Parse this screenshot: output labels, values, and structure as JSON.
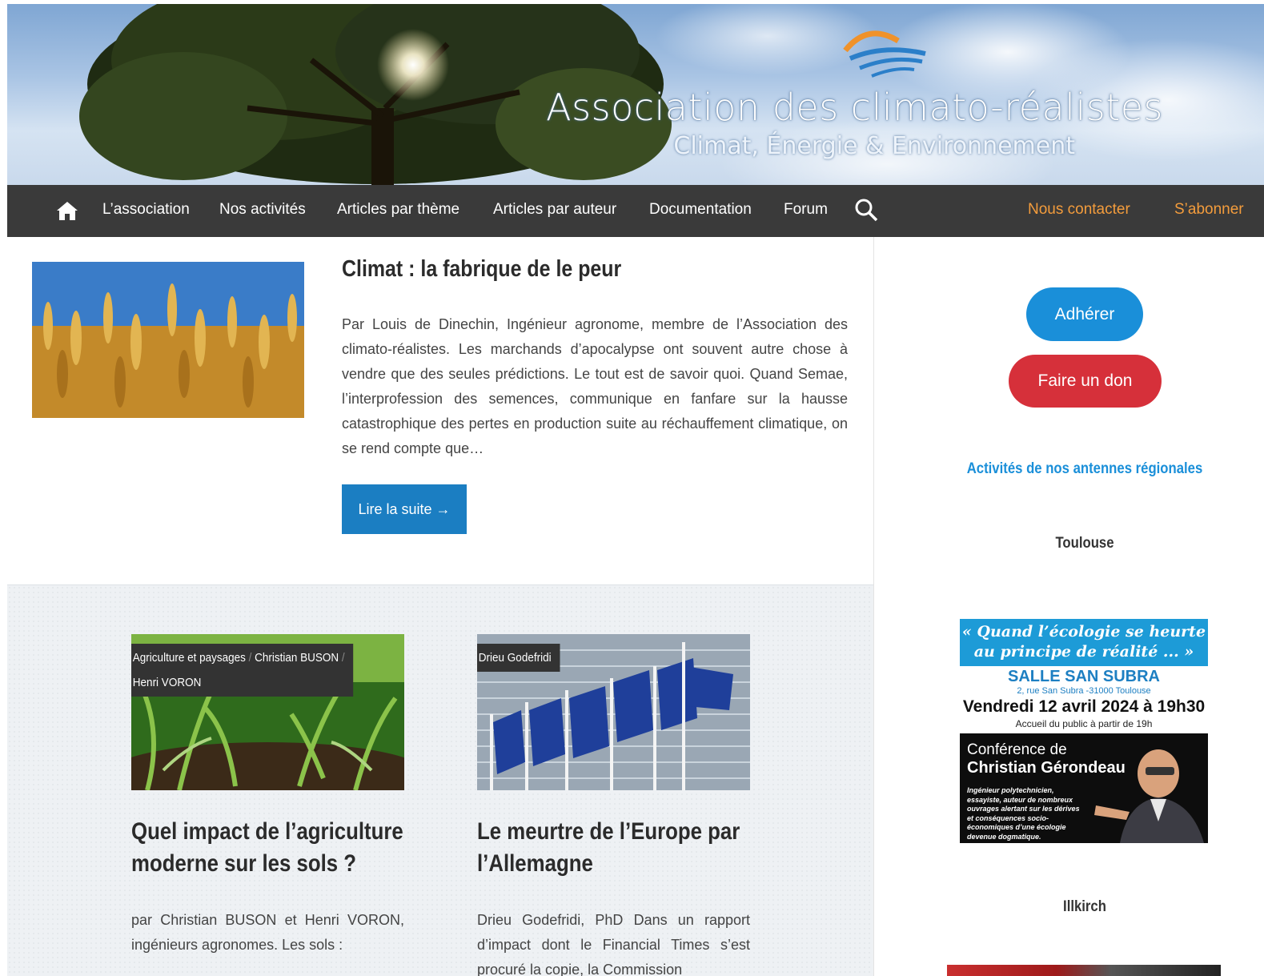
{
  "header": {
    "site_title": "Association des climato-réalistes",
    "tagline": "Climat, Énergie & Environnement"
  },
  "nav": {
    "home_icon": "home-icon",
    "items": [
      "L’association",
      "Nos activités",
      "Articles par thème",
      "Articles par auteur",
      "Documentation",
      "Forum"
    ],
    "search_icon": "search-icon",
    "contact": "Nous contacter",
    "subscribe": "S’abonner"
  },
  "featured": {
    "title": "Climat : la fabrique de le peur",
    "excerpt": "Par Louis de Dinechin, Ingénieur agronome, membre de l’Association des climato-réalistes. Les marchands d’apocalypse ont souvent autre chose à vendre que des seules prédictions. Le tout est de savoir quoi. Quand Semae, l’interprofession des semences, communique en fanfare sur la hausse catastrophique des pertes en production suite au réchauffement climatique, on se rend compte que…",
    "read_more": "Lire la suite →"
  },
  "cards": [
    {
      "categories": [
        "Agriculture et paysages",
        "Christian BUSON",
        "Henri VORON"
      ],
      "title": "Quel impact de l’agriculture moderne sur les sols ?",
      "excerpt": "par Christian BUSON et Henri VORON, ingénieurs agronomes. Les sols :"
    },
    {
      "categories": [
        "Drieu Godefridi"
      ],
      "title": "Le meurtre de l’Europe par l’Allemagne",
      "excerpt": "Drieu Godefridi, PhD Dans un rapport d’impact dont le Financial Times s’est procuré la copie, la Commission"
    }
  ],
  "sidebar": {
    "join_button": "Adhérer",
    "donate_button": "Faire un don",
    "regional_heading": "Activités de nos antennes régionales",
    "city1": "Toulouse",
    "city2": "Illkirch",
    "poster": {
      "headline": "« Quand l’écologie se heurte au principe de réalité ... »",
      "venue": "SALLE SAN SUBRA",
      "address": "2, rue San Subra -31000 Toulouse",
      "date": "Vendredi 12 avril 2024 à 19h30",
      "welcome": "Accueil du public à partir de 19h",
      "conference": "Conférence de",
      "speaker": "Christian Gérondeau",
      "speaker_desc": "Ingénieur polytechnicien, essayiste, auteur de nombreux ouvrages alertant sur les dérives et conséquences socio-économiques d’une écologie devenue dogmatique."
    }
  },
  "colors": {
    "nav_bg": "#3a3a3a",
    "accent_orange": "#f39c3c",
    "primary_blue": "#1b7ec2",
    "donate_red": "#d6303a",
    "join_blue": "#1a8fd9"
  }
}
